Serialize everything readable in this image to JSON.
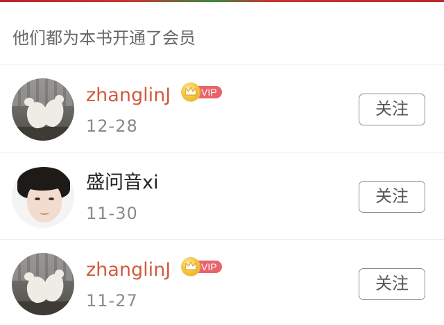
{
  "header": {
    "title": "他们都为本书开通了会员"
  },
  "members": [
    {
      "username": "zhanglinJ",
      "vip": true,
      "vip_label": "VIP",
      "date": "12-28",
      "follow_label": "关注",
      "avatar_icon": "pigeons-avatar"
    },
    {
      "username": "盛问音xi",
      "vip": false,
      "date": "11-30",
      "follow_label": "关注",
      "avatar_icon": "person-avatar"
    },
    {
      "username": "zhanglinJ",
      "vip": true,
      "vip_label": "VIP",
      "date": "11-27",
      "follow_label": "关注",
      "avatar_icon": "pigeons-avatar"
    }
  ],
  "colors": {
    "vip_username": "#d35b3c",
    "vip_badge": "#e9636a",
    "crown": "#f6c744",
    "date_text": "#8a8a8a",
    "header_text": "#666666"
  }
}
